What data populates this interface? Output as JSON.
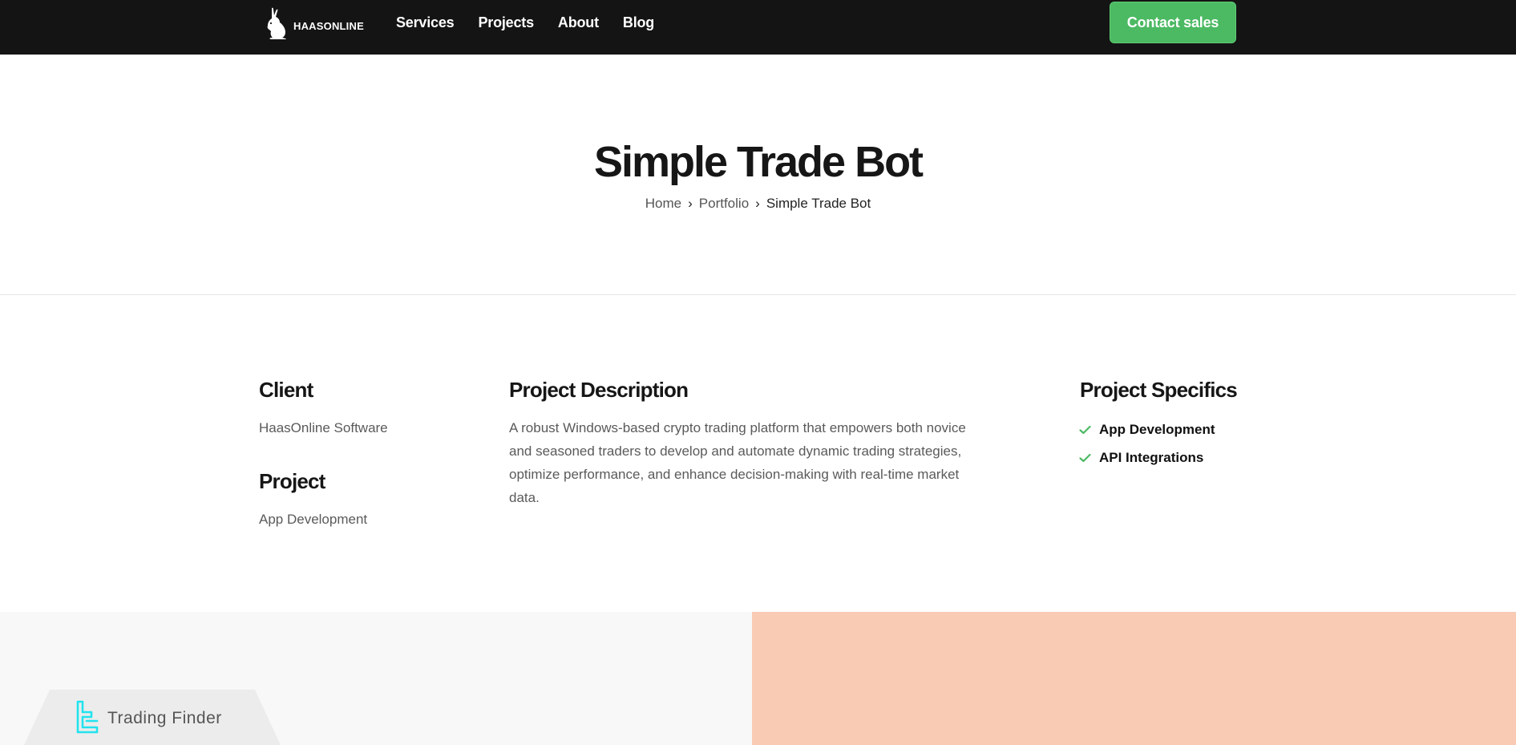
{
  "header": {
    "logo_text": "HAASONLINE",
    "nav": [
      "Services",
      "Projects",
      "About",
      "Blog"
    ],
    "cta_label": "Contact sales"
  },
  "hero": {
    "title": "Simple Trade Bot",
    "breadcrumb": [
      "Home",
      "Portfolio",
      "Simple Trade Bot"
    ],
    "separator": "›"
  },
  "details": {
    "client_title": "Client",
    "client_value": "HaasOnline Software",
    "project_title": "Project",
    "project_value": "App Development",
    "description_title": "Project Description",
    "description_text": "A robust Windows-based crypto trading platform that empowers both novice and seasoned traders to develop and automate dynamic trading strategies, optimize performance, and enhance decision-making with real-time market data.",
    "specifics_title": "Project Specifics",
    "specifics": [
      "App Development",
      "API Integrations"
    ]
  },
  "watermark": {
    "text": "Trading Finder"
  },
  "colors": {
    "topbar": "#141414",
    "accent_green": "#4cb963",
    "panel_left": "#f8f8f9",
    "panel_right": "#f9cbb4",
    "watermark_cyan": "#22e3ee"
  },
  "icons": {
    "logo": "rabbit-icon",
    "spec_bullet": "check-icon",
    "watermark": "trading-finder-logo-icon"
  }
}
